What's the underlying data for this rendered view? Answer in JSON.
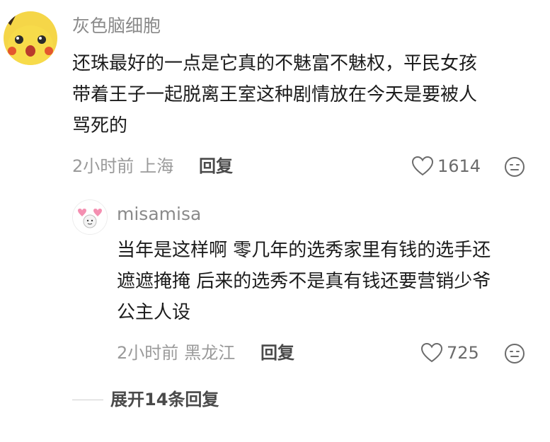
{
  "comment": {
    "username": "灰色脑细胞",
    "avatar": "pikachu-avatar",
    "text_lines": [
      "还珠最好的一点是它真的不魅富不魅权，平民女孩",
      "带着王子一起脱离王室这种剧情放在今天是要被人",
      "骂死的"
    ],
    "time": "2小时前",
    "location": "上海",
    "reply_label": "回复",
    "likes": "1614",
    "like_icon": "heart-outline-icon",
    "emoji_icon": "smiley-face-icon"
  },
  "reply": {
    "username": "misamisa",
    "avatar": "cartoon-with-hearts-avatar",
    "text_lines": [
      "当年是这样啊 零几年的选秀家里有钱的选手还",
      "遮遮掩掩 后来的选秀不是真有钱还要营销少爷",
      "公主人设"
    ],
    "time": "2小时前",
    "location": "黑龙江",
    "reply_label": "回复",
    "likes": "725",
    "like_icon": "heart-outline-icon",
    "emoji_icon": "smiley-face-icon"
  },
  "expand_replies_label": "展开14条回复",
  "colors": {
    "username": "#8a8a8a",
    "meta": "#9a9a9a",
    "text": "#1c1c1c",
    "action": "#4a4a4a"
  }
}
